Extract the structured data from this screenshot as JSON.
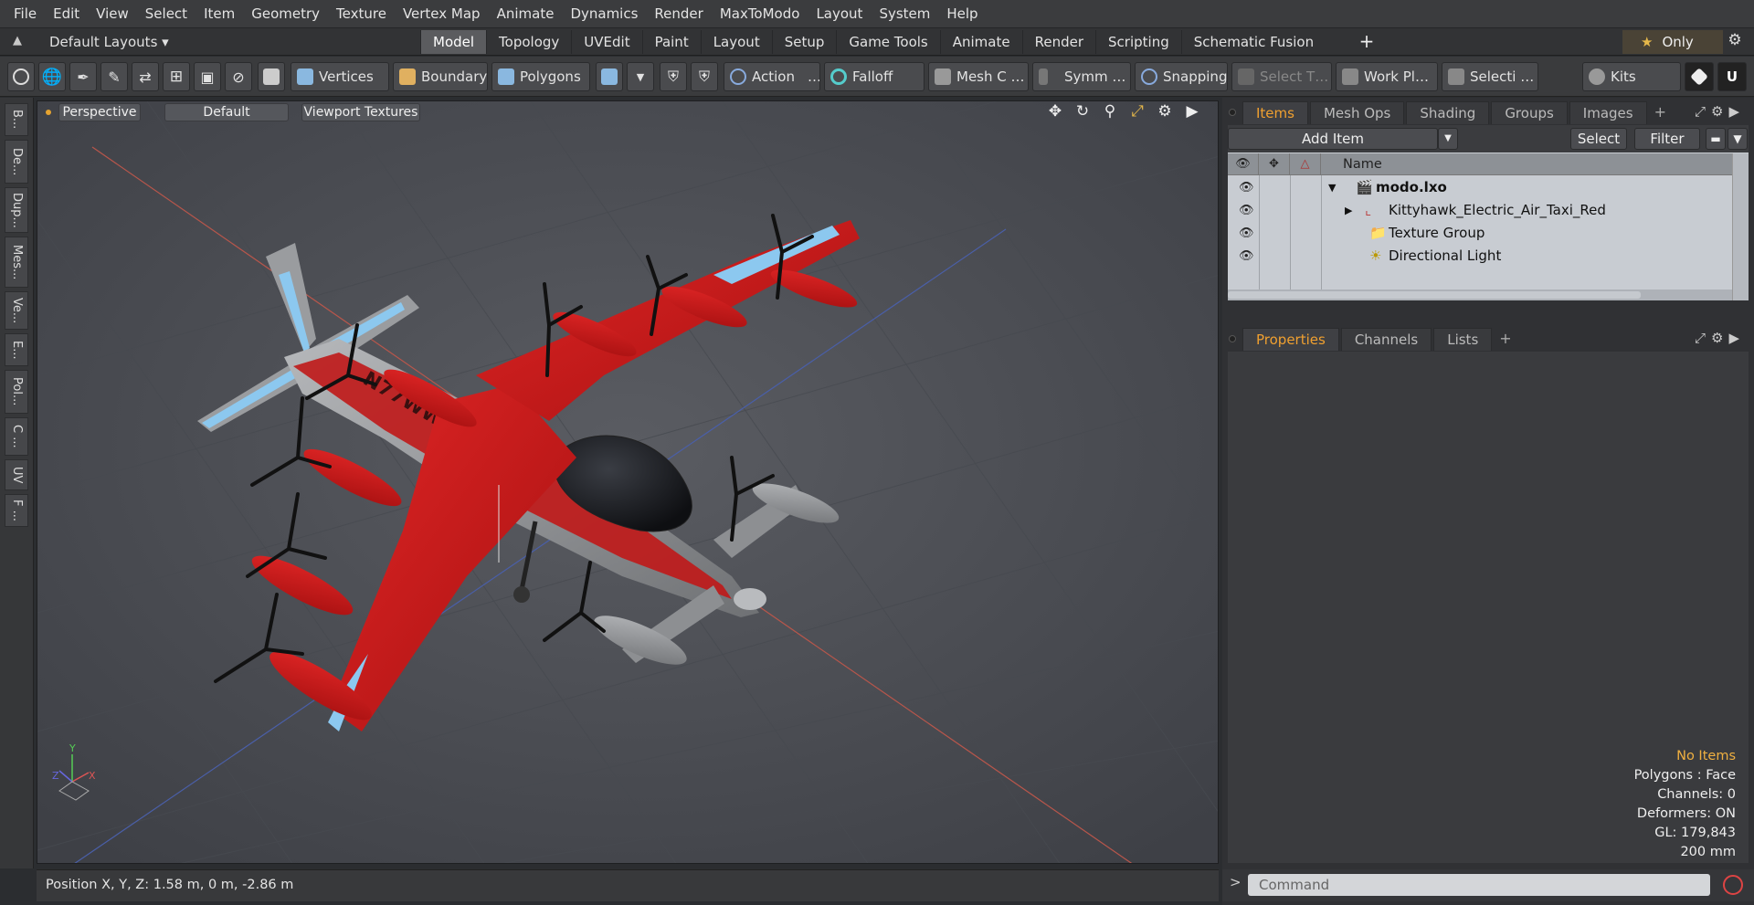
{
  "menubar": [
    "File",
    "Edit",
    "View",
    "Select",
    "Item",
    "Geometry",
    "Texture",
    "Vertex Map",
    "Animate",
    "Dynamics",
    "Render",
    "MaxToModo",
    "Layout",
    "System",
    "Help"
  ],
  "layoutbar": {
    "layout_dropdown": "Default Layouts ▾",
    "tabs": [
      "Model",
      "Topology",
      "UVEdit",
      "Paint",
      "Layout",
      "Setup",
      "Game Tools",
      "Animate",
      "Render",
      "Scripting",
      "Schematic Fusion"
    ],
    "active_tab": "Model",
    "add_tab": "+",
    "only_label": "Only"
  },
  "toolbar": {
    "vertices": "Vertices",
    "boundary": "Boundary",
    "polygons": "Polygons",
    "action": "Action",
    "action_more": "…",
    "falloff": "Falloff",
    "mesh": "Mesh C …",
    "symmetry": "Symm …",
    "snapping": "Snapping",
    "select_t": "Select T…",
    "work_plane": "Work Pl…",
    "selection": "Selecti …",
    "kits": "Kits"
  },
  "left_tabs": [
    "B...",
    "De...",
    "Dup...",
    "Mes...",
    "Ve...",
    "E...",
    "Pol...",
    "C ...",
    "UV",
    "F ..."
  ],
  "viewport": {
    "perspective": "Perspective",
    "default": "Default",
    "textures": "Viewport Textures",
    "registration": "N77WW",
    "info": {
      "no_items": "No Items",
      "polygons": "Polygons : Face",
      "channels": "Channels: 0",
      "deformers": "Deformers: ON",
      "gl": "GL: 179,843",
      "unit": "200 mm"
    },
    "axis": {
      "x": "X",
      "y": "Y",
      "z": "Z"
    }
  },
  "status": {
    "position": "Position X, Y, Z:   1.58 m, 0 m, -2.86 m"
  },
  "items_panel": {
    "tabs": [
      "Items",
      "Mesh Ops",
      "Shading",
      "Groups",
      "Images"
    ],
    "active_tab": "Items",
    "add": "+",
    "add_item": "Add Item",
    "select": "Select",
    "filter": "Filter",
    "name_header": "Name",
    "rows": [
      {
        "label": "modo.lxo",
        "bold": true
      },
      {
        "label": "Kittyhawk_Electric_Air_Taxi_Red",
        "bold": false
      },
      {
        "label": "Texture Group",
        "bold": false
      },
      {
        "label": "Directional Light",
        "bold": false
      }
    ]
  },
  "props_panel": {
    "tabs": [
      "Properties",
      "Channels",
      "Lists"
    ],
    "active_tab": "Properties",
    "add": "+"
  },
  "command": {
    "placeholder": "Command",
    "prompt": ">"
  },
  "colors": {
    "accent": "#f0a030",
    "aircraft_red": "#d81c1c",
    "aircraft_grey": "#9a9c9f",
    "accent_blue": "#8cc8ef"
  }
}
